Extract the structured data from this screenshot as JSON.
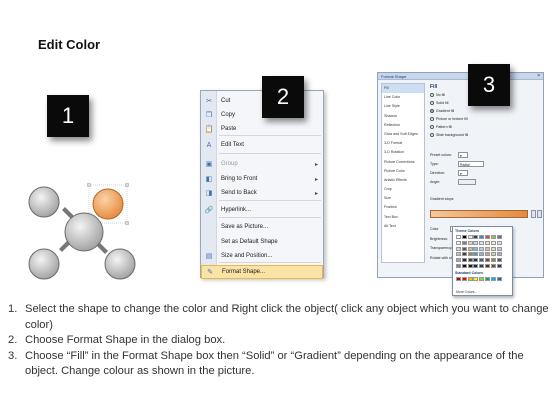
{
  "page": {
    "title": "Edit Color"
  },
  "steps": [
    "1",
    "2",
    "3"
  ],
  "context_menu": {
    "items": [
      {
        "label": "Cut",
        "icon": "scissors-icon",
        "glyph": "✂",
        "submenu": false,
        "disabled": false,
        "highlight": false
      },
      {
        "label": "Copy",
        "icon": "copy-icon",
        "glyph": "❐",
        "submenu": false,
        "disabled": false,
        "highlight": false
      },
      {
        "label": "Paste",
        "icon": "paste-icon",
        "glyph": "📋",
        "submenu": false,
        "disabled": false,
        "highlight": false
      },
      {
        "label": "Edit Text",
        "icon": "edit-text-icon",
        "glyph": "A",
        "submenu": false,
        "disabled": false,
        "highlight": false
      },
      {
        "label": "Group",
        "icon": "group-icon",
        "glyph": "▣",
        "submenu": true,
        "disabled": true,
        "highlight": false
      },
      {
        "label": "Bring to Front",
        "icon": "bring-front-icon",
        "glyph": "◧",
        "submenu": true,
        "disabled": false,
        "highlight": false
      },
      {
        "label": "Send to Back",
        "icon": "send-back-icon",
        "glyph": "◨",
        "submenu": true,
        "disabled": false,
        "highlight": false
      },
      {
        "label": "Hyperlink...",
        "icon": "hyperlink-icon",
        "glyph": "🔗",
        "submenu": false,
        "disabled": false,
        "highlight": false
      },
      {
        "label": "Save as Picture...",
        "icon": "",
        "glyph": "",
        "submenu": false,
        "disabled": false,
        "highlight": false
      },
      {
        "label": "Set as Default Shape",
        "icon": "",
        "glyph": "",
        "submenu": false,
        "disabled": false,
        "highlight": false
      },
      {
        "label": "Size and Position...",
        "icon": "size-icon",
        "glyph": "▤",
        "submenu": false,
        "disabled": false,
        "highlight": false
      },
      {
        "label": "Format Shape...",
        "icon": "format-shape-icon",
        "glyph": "✎",
        "submenu": false,
        "disabled": false,
        "highlight": true
      }
    ]
  },
  "dialog": {
    "title": "Format Shape",
    "categories": [
      "Fill",
      "Line Color",
      "Line Style",
      "Shadow",
      "Reflection",
      "Glow and Soft Edges",
      "3-D Format",
      "3-D Rotation",
      "Picture Corrections",
      "Picture Color",
      "Artistic Effects",
      "Crop",
      "Size",
      "Position",
      "Text Box",
      "Alt Text"
    ],
    "heading": "Fill",
    "fill_options": [
      "No fill",
      "Solid fill",
      "Gradient fill",
      "Picture or texture fill",
      "Pattern fill",
      "Slide background fill"
    ],
    "selected_fill": "Gradient fill",
    "preset_label": "Preset colors:",
    "type_label": "Type:",
    "type_value": "Radial",
    "direction_label": "Direction:",
    "angle_label": "Angle:",
    "stops_label": "Gradient stops",
    "color_label": "Color",
    "position_label": "Position:",
    "position_value": "100%",
    "brightness_label": "Brightness:",
    "transparency_label": "Transparency:",
    "rotate_label": "Rotate with shape"
  },
  "palette": {
    "theme_label": "Theme Colors",
    "standard_label": "Standard Colors",
    "more_label": "More Colors...",
    "theme_rows": [
      [
        "#ffffff",
        "#000000",
        "#eeece1",
        "#1f497d",
        "#4f81bd",
        "#c0504d",
        "#9bbb59",
        "#8064a2"
      ],
      [
        "#f2f2f2",
        "#7f7f7f",
        "#ddd9c3",
        "#c6d9f0",
        "#dbe5f1",
        "#f2dcdb",
        "#ebf1dd",
        "#e5e0ec"
      ],
      [
        "#d8d8d8",
        "#595959",
        "#c4bd97",
        "#8db3e2",
        "#b8cce4",
        "#e5b9b7",
        "#d7e3bc",
        "#ccc1d9"
      ],
      [
        "#bfbfbf",
        "#3f3f3f",
        "#938953",
        "#548dd4",
        "#95b3d7",
        "#d99694",
        "#c3d69b",
        "#b2a2c7"
      ],
      [
        "#a5a5a5",
        "#262626",
        "#494429",
        "#17365d",
        "#366092",
        "#953734",
        "#76923c",
        "#5f497a"
      ],
      [
        "#7f7f7f",
        "#0c0c0c",
        "#1d1b10",
        "#0f243e",
        "#244061",
        "#632423",
        "#4f6128",
        "#3f3151"
      ]
    ],
    "standard_row": [
      "#c00000",
      "#ff0000",
      "#ffc000",
      "#ffff00",
      "#92d050",
      "#00b050",
      "#00b0f0",
      "#0070c0"
    ]
  },
  "instructions": [
    {
      "num": "1.",
      "text": "Select the shape to change the color and Right click the object( click any object which you want to change color)"
    },
    {
      "num": "2.",
      "text": "Choose Format Shape in the dialog box."
    },
    {
      "num": "3.",
      "text": "Choose “Fill” in the Format Shape box then “Solid” or “Gradient” depending on the appearance of the object. Change colour as shown in the picture."
    }
  ],
  "colors": {
    "selected_circle": "#f4a460",
    "circle": "#c8c8c8",
    "highlight": "#fbe3a6"
  }
}
